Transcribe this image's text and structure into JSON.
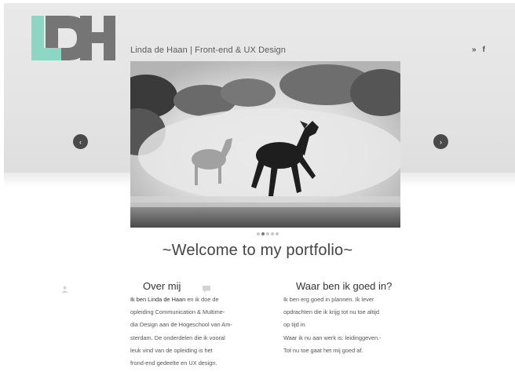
{
  "header": {
    "site_title": "Linda de Haan | Front-end & UX Design",
    "social": [
      "twitter-icon",
      "facebook-icon"
    ],
    "social_glyphs": [
      "»",
      "f"
    ]
  },
  "carousel": {
    "prev_glyph": "‹",
    "next_glyph": "›",
    "slide_count": 5,
    "active_slide": 2
  },
  "welcome": "~Welcome to my portfolio~",
  "over_mij": {
    "title": "Over mij",
    "lead": "Ik ben Linda de Haan",
    "lines": [
      " en ik doe de",
      "opleiding Communication & Multime-",
      "dia Design aan de Hogeschool van Am-",
      "sterdam. De onderdelen die ik vooral",
      "leuk vind van de opleiding is het",
      "frond-end gedeelte en UX design."
    ]
  },
  "goed_in": {
    "title": "Waar ben ik goed in?",
    "lines": [
      "Ik ben erg goed in plannen. Ik lever",
      "opdrachten die ik krijg tot nu toe altijd",
      "op tijd in.",
      "Waar ik nu aan werk is: leidinggeven.-",
      "Tot nu toe gaat het mij goed af."
    ]
  },
  "colors": {
    "logo_teal": "#8ed6c4",
    "logo_gray": "#757575",
    "arrow_bg": "#4a4a4a"
  }
}
